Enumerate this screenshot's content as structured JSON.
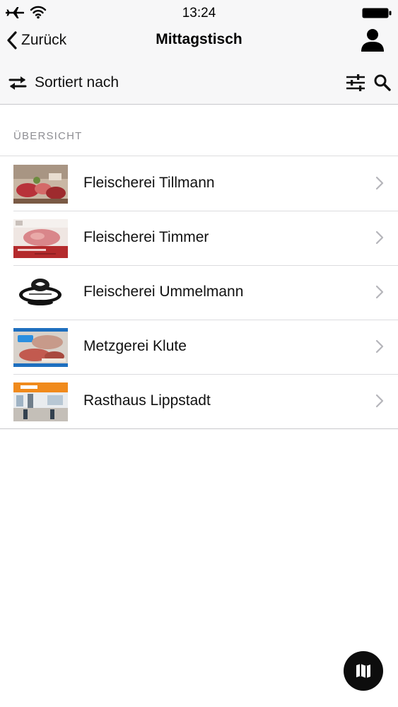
{
  "status_bar": {
    "time": "13:24",
    "icons": [
      "airplane-icon",
      "wifi-icon",
      "battery-icon"
    ]
  },
  "nav": {
    "back_label": "Zurück",
    "title": "Mittagstisch",
    "right_icon": "profile-icon"
  },
  "toolbar": {
    "sort_label": "Sortiert nach",
    "icons": [
      "sort-arrows-icon",
      "filter-sliders-icon",
      "search-icon"
    ]
  },
  "section": {
    "header": "ÜBERSICHT"
  },
  "items": [
    {
      "name": "Fleischerei Tillmann"
    },
    {
      "name": "Fleischerei Timmer"
    },
    {
      "name": "Fleischerei Ummelmann"
    },
    {
      "name": "Metzgerei Klute"
    },
    {
      "name": "Rasthaus Lippstadt"
    }
  ],
  "fab": {
    "icon": "map-icon"
  },
  "colors": {
    "bar_background": "#f7f7f8",
    "separator": "#dcdcdf",
    "section_header": "#8e8e93",
    "fab": "#0d0d0d"
  }
}
